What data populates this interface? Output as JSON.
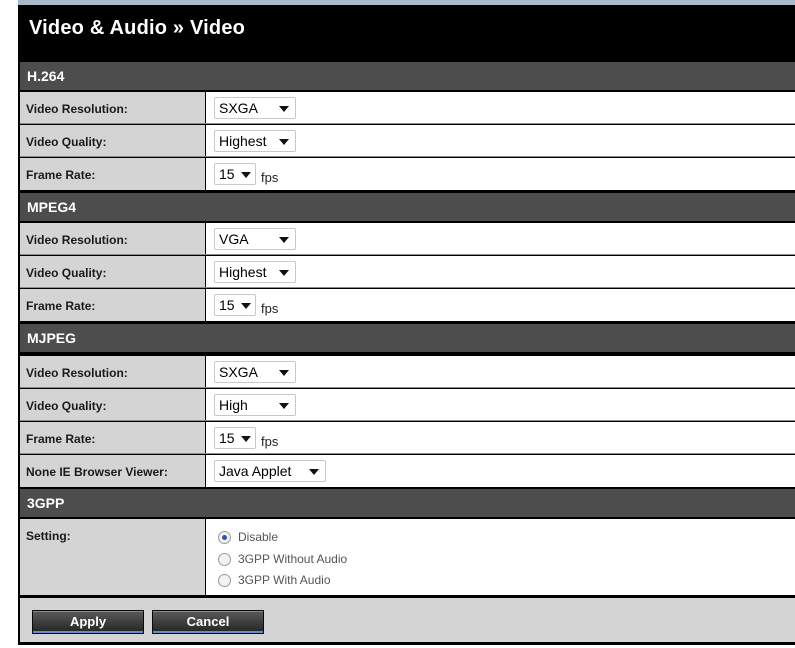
{
  "page_title": "Video & Audio » Video",
  "sections": {
    "h264": {
      "title": "H.264",
      "rows": {
        "resolution": {
          "label": "Video Resolution:",
          "value": "SXGA"
        },
        "quality": {
          "label": "Video Quality:",
          "value": "Highest"
        },
        "frame_rate": {
          "label": "Frame Rate:",
          "value": "15",
          "unit": "fps"
        }
      }
    },
    "mpeg4": {
      "title": "MPEG4",
      "rows": {
        "resolution": {
          "label": "Video Resolution:",
          "value": "VGA"
        },
        "quality": {
          "label": "Video Quality:",
          "value": "Highest"
        },
        "frame_rate": {
          "label": "Frame Rate:",
          "value": "15",
          "unit": "fps"
        }
      }
    },
    "mjpeg": {
      "title": "MJPEG",
      "rows": {
        "resolution": {
          "label": "Video Resolution:",
          "value": "SXGA"
        },
        "quality": {
          "label": "Video Quality:",
          "value": "High"
        },
        "frame_rate": {
          "label": "Frame Rate:",
          "value": "15",
          "unit": "fps"
        },
        "viewer": {
          "label": "None IE Browser Viewer:",
          "value": "Java Applet"
        }
      }
    },
    "gpp3": {
      "title": "3GPP",
      "setting_label": "Setting:",
      "options": [
        {
          "label": "Disable",
          "selected": true
        },
        {
          "label": "3GPP Without Audio",
          "selected": false
        },
        {
          "label": "3GPP With Audio",
          "selected": false
        }
      ]
    }
  },
  "buttons": {
    "apply": "Apply",
    "cancel": "Cancel"
  },
  "colors": {
    "header_bg": "#000000",
    "section_bg": "#4d4d4d",
    "label_bg": "#d4d4d4",
    "radio_selected": "#2a55b0"
  }
}
